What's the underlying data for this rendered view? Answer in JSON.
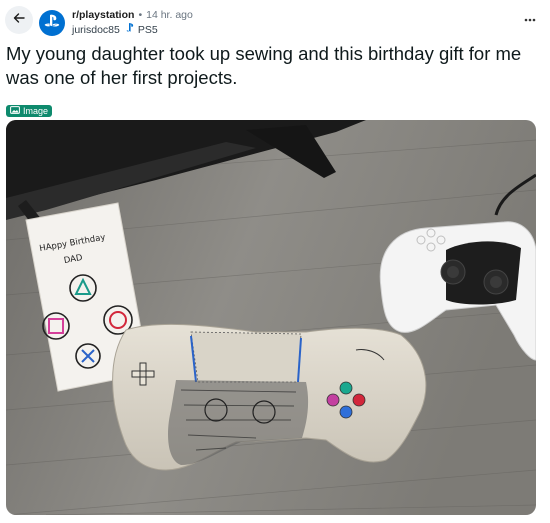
{
  "post": {
    "subreddit": "r/playstation",
    "separator": "•",
    "time_ago": "14 hr. ago",
    "author": "jurisdoc85",
    "flair": "PS5",
    "title": "My young daughter took up sewing and this birthday gift for me was one of her first projects.",
    "type_badge": "Image"
  },
  "card": {
    "line1": "HAppy Birthday",
    "line2": "DAD"
  },
  "colors": {
    "accent": "#0070d1",
    "badge": "#0e8a6d",
    "table": "#8a8882"
  },
  "icons": {
    "back": "arrow-left-icon",
    "avatar": "playstation-logo-icon",
    "flair": "controller-flair-icon",
    "more": "more-dots-icon",
    "badge": "image-icon"
  }
}
